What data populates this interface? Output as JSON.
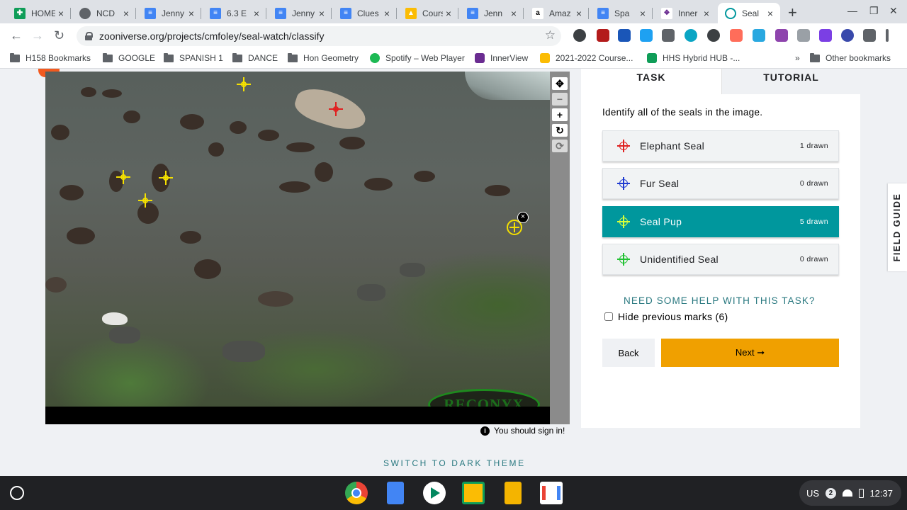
{
  "browser": {
    "tabs": [
      {
        "title": "HOME",
        "close": "×",
        "color": "#0f9d58"
      },
      {
        "title": "NCD",
        "close": "×",
        "color": "#5f6368"
      },
      {
        "title": "Jenny",
        "close": "×",
        "color": "#4285f4"
      },
      {
        "title": "6.3 E",
        "close": "×",
        "color": "#4285f4"
      },
      {
        "title": "Jenny",
        "close": "×",
        "color": "#4285f4"
      },
      {
        "title": "Clues",
        "close": "×",
        "color": "#4285f4"
      },
      {
        "title": "Cours",
        "close": "×",
        "color": "#fbbc04"
      },
      {
        "title": "Jenn",
        "close": "×",
        "color": "#4285f4"
      },
      {
        "title": "Amaz",
        "close": "×",
        "color": "#000000"
      },
      {
        "title": "Spa",
        "close": "×",
        "color": "#4285f4"
      },
      {
        "title": "Inner",
        "close": "×",
        "color": "#6a2c91"
      },
      {
        "title": "Seal",
        "close": "×",
        "color": "#00979d"
      }
    ],
    "new_tab": "+",
    "window_controls": {
      "minimize": "—",
      "restore": "❐",
      "close": "✕"
    },
    "nav": {
      "back": "←",
      "forward": "→",
      "reload": "↻"
    },
    "url": "zooniverse.org/projects/cmfoley/seal-watch/classify",
    "bookmark_star": "☆",
    "bookmarks": [
      {
        "label": "H158 Bookmarks",
        "icon": "folder"
      },
      {
        "label": "GOOGLE",
        "icon": "folder"
      },
      {
        "label": "SPANISH 1",
        "icon": "folder"
      },
      {
        "label": "DANCE",
        "icon": "folder"
      },
      {
        "label": "Hon Geometry",
        "icon": "folder"
      },
      {
        "label": "Spotify – Web Player",
        "icon": "spotify-icon"
      },
      {
        "label": "InnerView",
        "icon": "innerview-icon"
      },
      {
        "label": "2021-2022 Course...",
        "icon": "drive-icon"
      },
      {
        "label": "HHS Hybrid HUB -...",
        "icon": "sheets-icon"
      }
    ],
    "bookmarks_overflow": "»",
    "other_bookmarks": "Other bookmarks"
  },
  "viewer": {
    "watermark": "RECONYX",
    "delete_mark": "×",
    "marks": {
      "elephant_color": "#e02020",
      "pup_color": "#f4e000"
    },
    "tools": {
      "move": "✥",
      "zoom_out": "−",
      "zoom_in": "+",
      "rotate": "↻",
      "reset": "⟳"
    },
    "signin_notice": "You should sign in!",
    "info_icon": "i"
  },
  "task": {
    "tabs": {
      "task": "TASK",
      "tutorial": "TUTORIAL"
    },
    "instruction": "Identify all of the seals in the image.",
    "options": [
      {
        "name": "Elephant Seal",
        "count": "1 drawn",
        "color": "#e02020"
      },
      {
        "name": "Fur Seal",
        "count": "0 drawn",
        "color": "#1f3bd1"
      },
      {
        "name": "Seal Pup",
        "count": "5 drawn",
        "color": "#d8ff3a"
      },
      {
        "name": "Unidentified Seal",
        "count": "0 drawn",
        "color": "#22c233"
      }
    ],
    "help": "NEED SOME HELP WITH THIS TASK?",
    "hide_marks": "Hide previous marks (6)",
    "back": "Back",
    "next": "Next ➞"
  },
  "field_guide": "FIELD GUIDE",
  "theme_switch": "SWITCH TO DARK THEME",
  "shelf": {
    "locale": "US",
    "notifications": "2",
    "time": "12:37"
  }
}
